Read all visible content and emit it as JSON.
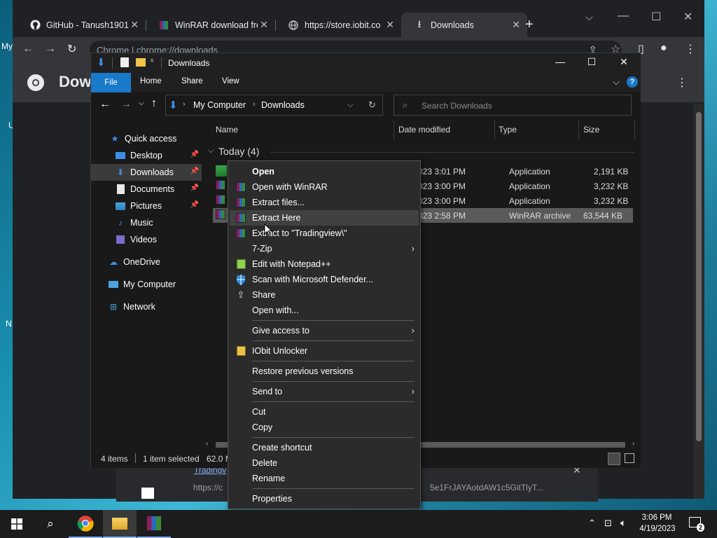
{
  "desktop": {
    "labels": [
      "My",
      "U",
      "N"
    ]
  },
  "chrome": {
    "tabs": [
      {
        "label": "GitHub - Tanush1901",
        "icon": "github-icon"
      },
      {
        "label": "WinRAR download fre",
        "icon": "winrar-icon"
      },
      {
        "label": "https://store.iobit.co",
        "icon": "globe-icon"
      },
      {
        "label": "Downloads",
        "icon": "download-icon",
        "active": true
      }
    ],
    "omnibox_text": "Chrome | chrome://downloads",
    "page_title": "Downloads",
    "download_link": "Tradingv",
    "download_url": "https://c",
    "download_url_tail": "5e1FrJAYAotdAW1c5GitTlyT..."
  },
  "explorer": {
    "title": "Downloads",
    "ribbon_tabs": [
      "File",
      "Home",
      "Share",
      "View"
    ],
    "breadcrumb": [
      "My Computer",
      "Downloads"
    ],
    "search_placeholder": "Search Downloads",
    "nav": {
      "quick_access": "Quick access",
      "items": [
        {
          "label": "Desktop",
          "icon": "desktop-icon",
          "pinned": true
        },
        {
          "label": "Downloads",
          "icon": "download-icon",
          "pinned": true,
          "selected": true
        },
        {
          "label": "Documents",
          "icon": "document-icon",
          "pinned": true
        },
        {
          "label": "Pictures",
          "icon": "pictures-icon",
          "pinned": true
        },
        {
          "label": "Music",
          "icon": "music-icon"
        },
        {
          "label": "Videos",
          "icon": "videos-icon"
        }
      ],
      "onedrive": "OneDrive",
      "my_computer": "My Computer",
      "network": "Network"
    },
    "columns": [
      "Name",
      "Date modified",
      "Type",
      "Size"
    ],
    "group_label": "Today (4)",
    "files": [
      {
        "date": "023 3:01 PM",
        "type": "Application",
        "size": "2,191 KB"
      },
      {
        "date": "023 3:00 PM",
        "type": "Application",
        "size": "3,232 KB"
      },
      {
        "date": "023 3:00 PM",
        "type": "Application",
        "size": "3,232 KB"
      },
      {
        "date": "023 2:58 PM",
        "type": "WinRAR archive",
        "size": "63,544 KB",
        "selected": true
      }
    ],
    "status": {
      "items": "4 items",
      "selected": "1 item selected",
      "size": "62.0 M"
    }
  },
  "context_menu": {
    "items": [
      {
        "label": "Open",
        "bold": true
      },
      {
        "label": "Open with WinRAR",
        "icon": "winrar-icon"
      },
      {
        "label": "Extract files...",
        "icon": "winrar-icon"
      },
      {
        "label": "Extract Here",
        "icon": "winrar-icon",
        "hover": true
      },
      {
        "label": "Extract to \"Tradingview\\\"",
        "icon": "winrar-icon"
      },
      {
        "label": "7-Zip",
        "submenu": true
      },
      {
        "label": "Edit with Notepad++",
        "icon": "notepad-icon"
      },
      {
        "label": "Scan with Microsoft Defender...",
        "icon": "defender-icon"
      },
      {
        "label": "Share",
        "icon": "share-icon"
      },
      {
        "label": "Open with..."
      },
      {
        "label": "Give access to",
        "submenu": true
      },
      {
        "label": "IObit Unlocker",
        "icon": "lock-icon"
      },
      {
        "label": "Restore previous versions"
      },
      {
        "label": "Send to",
        "submenu": true
      },
      {
        "label": "Cut"
      },
      {
        "label": "Copy"
      },
      {
        "label": "Create shortcut"
      },
      {
        "label": "Delete"
      },
      {
        "label": "Rename"
      },
      {
        "label": "Properties"
      }
    ]
  },
  "taskbar": {
    "time": "3:06 PM",
    "date": "4/19/2023",
    "notification_count": "2"
  },
  "colors": {
    "accent_file_tab": "#1979ca",
    "chrome_bg": "#202124",
    "explorer_bg": "#191919",
    "menu_bg": "#2b2b2b"
  }
}
